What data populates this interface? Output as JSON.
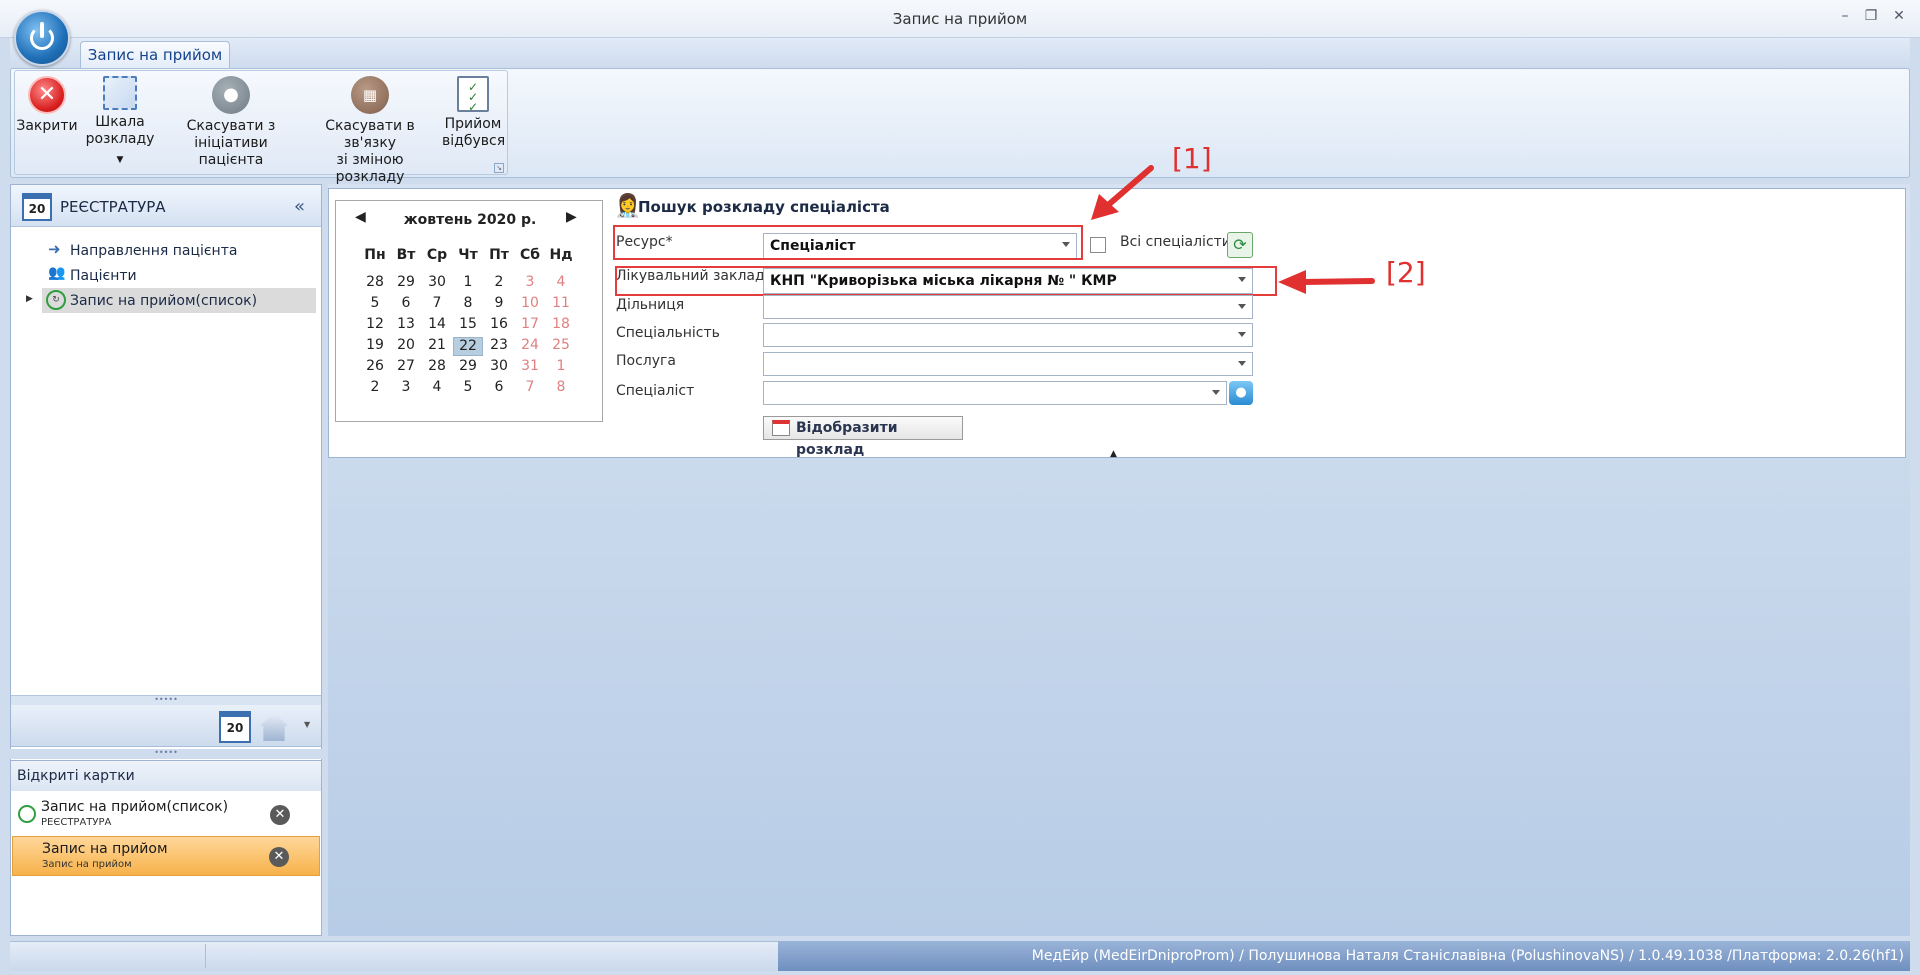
{
  "window": {
    "title": "Запис на прийом"
  },
  "ribbon": {
    "tab": "Запис на прийом",
    "buttons": {
      "close": "Закрити",
      "scale_l1": "Шкала",
      "scale_l2": "розкладу",
      "cancel_patient_l1": "Скасувати з",
      "cancel_patient_l2": "ініціативи пацієнта",
      "cancel_schedule_l1": "Скасувати в зв'язку",
      "cancel_schedule_l2": "зі зміною розкладу",
      "done_l1": "Прийом",
      "done_l2": "відбувся"
    }
  },
  "sidebar": {
    "title": "РЕЄСТРАТУРА",
    "items": [
      {
        "label": "Направлення пацієнта"
      },
      {
        "label": "Пацієнти"
      },
      {
        "label": "Запис на прийом(список)"
      }
    ],
    "calendar_icon_text": "20",
    "open_cards_title": "Відкриті картки",
    "cards": [
      {
        "title": "Запис на прийом(список)",
        "subtitle": "РЕЄСТРАТУРА"
      },
      {
        "title": "Запис на прийом",
        "subtitle": "Запис на прийом"
      }
    ]
  },
  "calendar": {
    "month": "жовтень 2020 р.",
    "weekdays": [
      "Пн",
      "Вт",
      "Ср",
      "Чт",
      "Пт",
      "Сб",
      "Нд"
    ],
    "weeks": [
      [
        "28",
        "29",
        "30",
        "1",
        "2",
        "3",
        "4"
      ],
      [
        "5",
        "6",
        "7",
        "8",
        "9",
        "10",
        "11"
      ],
      [
        "12",
        "13",
        "14",
        "15",
        "16",
        "17",
        "18"
      ],
      [
        "19",
        "20",
        "21",
        "22",
        "23",
        "24",
        "25"
      ],
      [
        "26",
        "27",
        "28",
        "29",
        "30",
        "31",
        "1"
      ],
      [
        "2",
        "3",
        "4",
        "5",
        "6",
        "7",
        "8"
      ]
    ],
    "selected": "22"
  },
  "search": {
    "title": "Пошук розкладу спеціаліста",
    "resource_label": "Ресурс*",
    "resource_value": "Спеціаліст",
    "all_specialists_label": "Всі спеціалісти",
    "facility_label": "Лікувальний заклад",
    "facility_value": "КНП \"Криворізька міська лікарня №  \" КМР",
    "district_label": "Дільниця",
    "specialty_label": "Спеціальність",
    "service_label": "Послуга",
    "specialist_label": "Спеціаліст",
    "show_button": "Відобразити розклад"
  },
  "annotations": {
    "a1": "[1]",
    "a2": "[2]"
  },
  "status": {
    "text": "МедЕйр (MedEirDniproProm) / Полушинова Наталя Станіславівна (PolushinovaNS) / 1.0.49.1038 /Платформа: 2.0.26(hf1)"
  }
}
